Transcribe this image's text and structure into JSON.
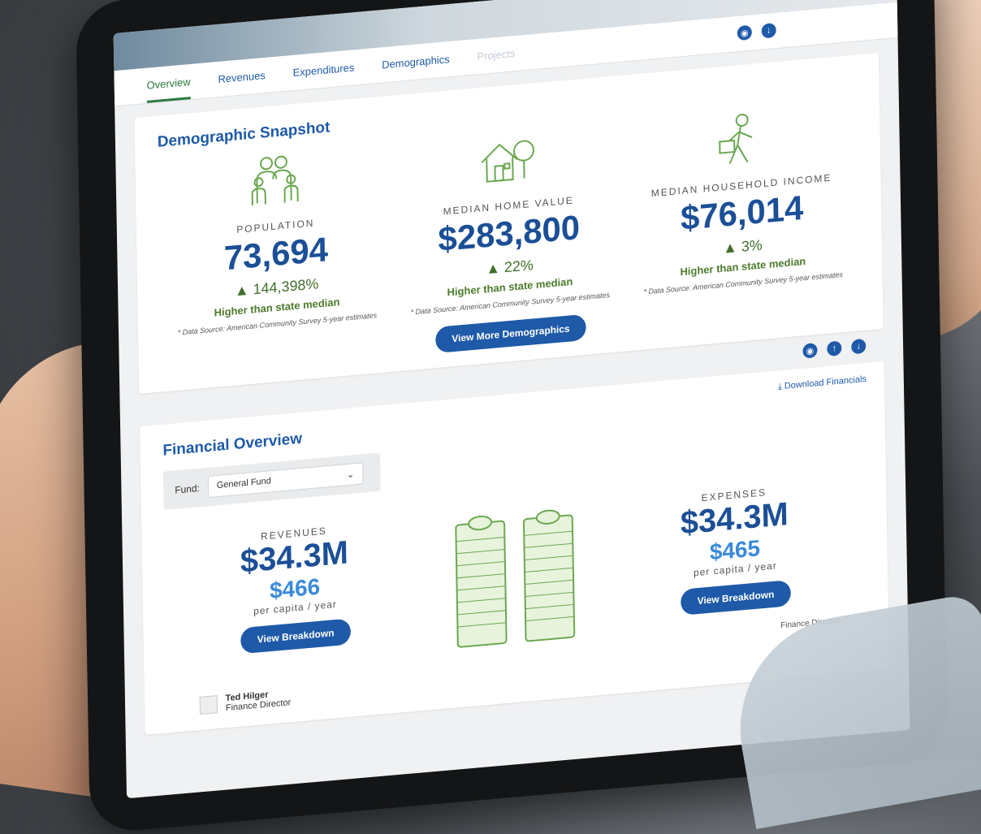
{
  "tabs": [
    {
      "label": "Overview",
      "active": true
    },
    {
      "label": "Revenues",
      "active": false
    },
    {
      "label": "Expenditures",
      "active": false
    },
    {
      "label": "Demographics",
      "active": false
    },
    {
      "label": "Projects",
      "active": false
    }
  ],
  "demographics": {
    "title": "Demographic Snapshot",
    "stats": [
      {
        "icon": "family-icon",
        "label": "POPULATION",
        "value": "73,694",
        "change": "▲ 144,398%",
        "compare": "Higher than state median",
        "source": "* Data Source: American Community Survey 5-year estimates"
      },
      {
        "icon": "house-icon",
        "label": "MEDIAN HOME VALUE",
        "value": "$283,800",
        "change": "▲ 22%",
        "compare": "Higher than state median",
        "source": "* Data Source: American Community Survey 5-year estimates"
      },
      {
        "icon": "walking-worker-icon",
        "label": "MEDIAN HOUSEHOLD INCOME",
        "value": "$76,014",
        "change": "▲ 3%",
        "compare": "Higher than state median",
        "source": "* Data Source: American Community Survey 5-year estimates"
      }
    ],
    "button": "View More Demographics"
  },
  "financial": {
    "title": "Financial Overview",
    "download": "Download Financials",
    "fund_label": "Fund:",
    "fund_value": "General Fund",
    "revenues": {
      "label": "REVENUES",
      "value": "$34.3M",
      "per_capita": "$466",
      "per_sub": "per capita / year",
      "button": "View Breakdown"
    },
    "expenses": {
      "label": "EXPENSES",
      "value": "$34.3M",
      "per_capita": "$465",
      "per_sub": "per capita / year",
      "button": "View Breakdown"
    },
    "director_name": "Ted Hilger",
    "director_title": "Finance Director",
    "director_title_right": "Finance Director"
  },
  "colors": {
    "brand_blue": "#1e5aa8",
    "brand_green": "#4d7a2c"
  }
}
